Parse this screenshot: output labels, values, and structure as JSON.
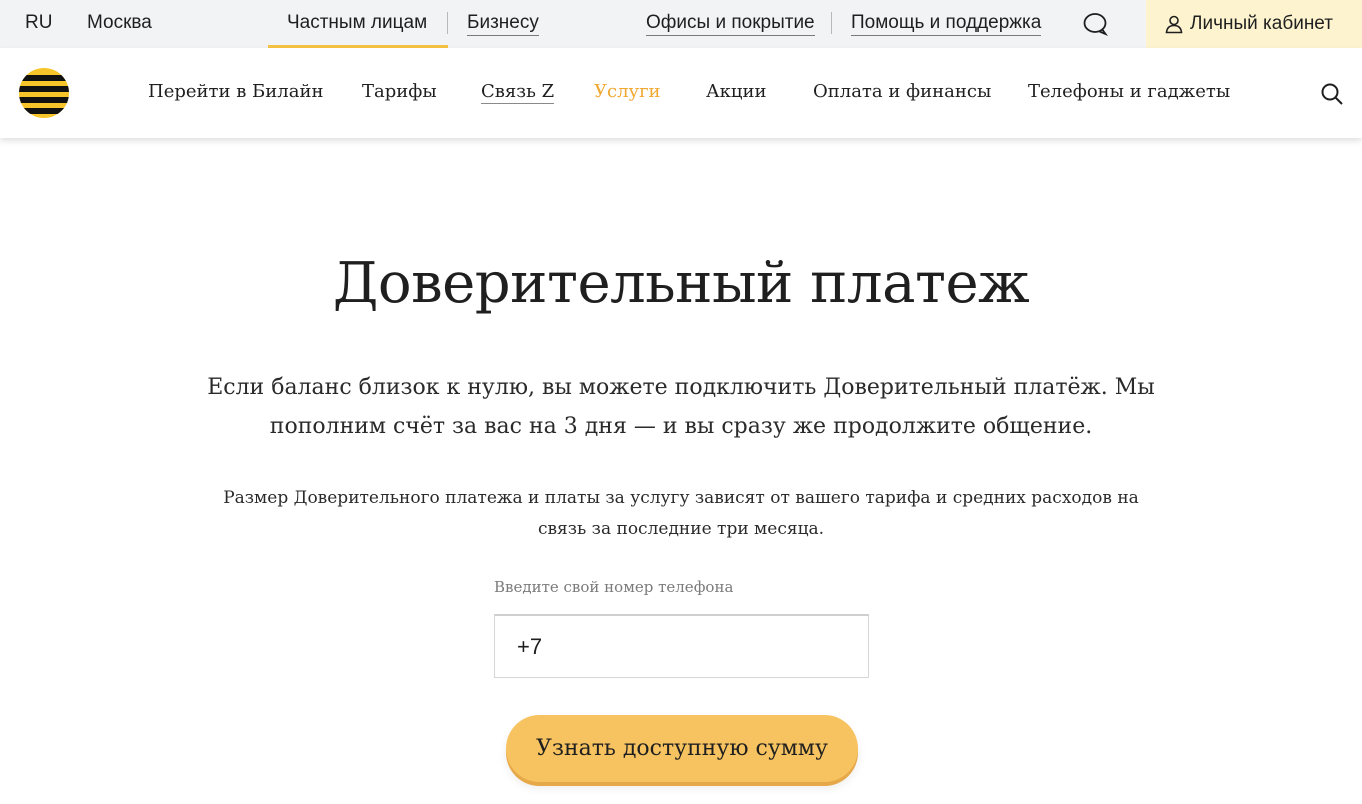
{
  "topbar": {
    "lang": "RU",
    "city": "Москва",
    "tab_private": "Частным лицам",
    "tab_business": "Бизнесу",
    "offices": "Офисы и покрытие",
    "help": "Помощь и поддержка",
    "cabinet": "Личный кабинет",
    "chat_icon": "chat-bubble-icon",
    "user_icon": "user-icon"
  },
  "nav": {
    "logo_icon": "beeline-logo-icon",
    "items": [
      "Перейти в Билайн",
      "Тарифы",
      "Связь Z",
      "Услуги",
      "Акции",
      "Оплата и финансы",
      "Телефоны и гаджеты"
    ],
    "active_index": 3,
    "search_icon": "search-icon"
  },
  "main": {
    "title": "Доверительный платеж",
    "lead": "Если баланс близок к нулю, вы можете подключить Доверительный платёж. Мы пополним счёт за вас на 3 дня — и вы сразу же продолжите общение.",
    "note": "Размер Доверительного платежа и платы за услугу зависят от вашего тарифа и средних расходов на связь за последние три месяца.",
    "phone_label": "Введите свой номер телефона",
    "phone_value": "+7",
    "cta": "Узнать доступную сумму"
  },
  "colors": {
    "accent": "#f5c242",
    "active_nav": "#f0a830",
    "cabinet_bg": "#fdf4cf",
    "button_bg": "#f7c361",
    "topbar_bg": "#f2f3f5"
  }
}
